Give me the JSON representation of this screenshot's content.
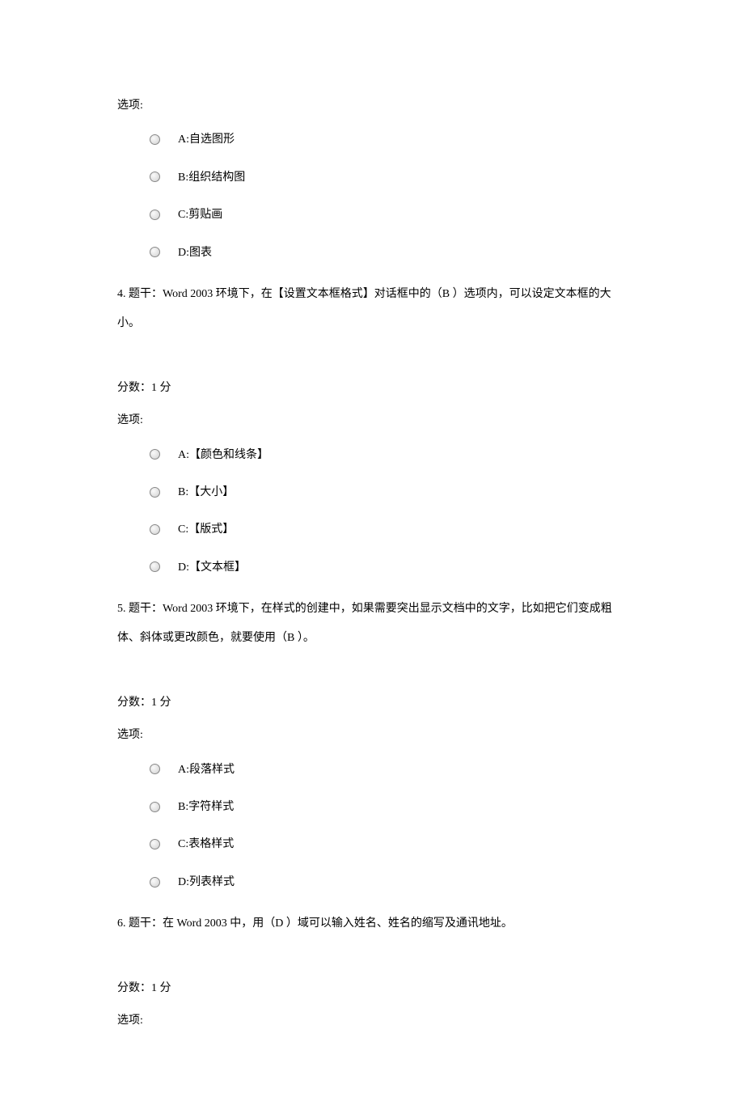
{
  "block1": {
    "options_label": "选项:",
    "options": [
      {
        "text": "A:自选图形"
      },
      {
        "text": "B:组织结构图"
      },
      {
        "text": "C:剪贴画"
      },
      {
        "text": "D:图表"
      }
    ]
  },
  "q4": {
    "stem": "4. 题干：Word 2003 环境下，在【设置文本框格式】对话框中的（B ）选项内，可以设定文本框的大小。",
    "score": "分数：1 分",
    "options_label": "选项:",
    "options": [
      {
        "text": "A:【颜色和线条】"
      },
      {
        "text": "B:【大小】"
      },
      {
        "text": "C:【版式】"
      },
      {
        "text": "D:【文本框】"
      }
    ]
  },
  "q5": {
    "stem": "5. 题干：Word 2003 环境下，在样式的创建中，如果需要突出显示文档中的文字，比如把它们变成粗体、斜体或更改颜色，就要使用（B ）。",
    "score": "分数：1 分",
    "options_label": "选项:",
    "options": [
      {
        "text": "A:段落样式"
      },
      {
        "text": "B:字符样式"
      },
      {
        "text": "C:表格样式"
      },
      {
        "text": "D:列表样式"
      }
    ]
  },
  "q6": {
    "stem": "6. 题干：在 Word 2003 中，用（D ）域可以输入姓名、姓名的缩写及通讯地址。",
    "score": "分数：1 分",
    "options_label": "选项:"
  }
}
